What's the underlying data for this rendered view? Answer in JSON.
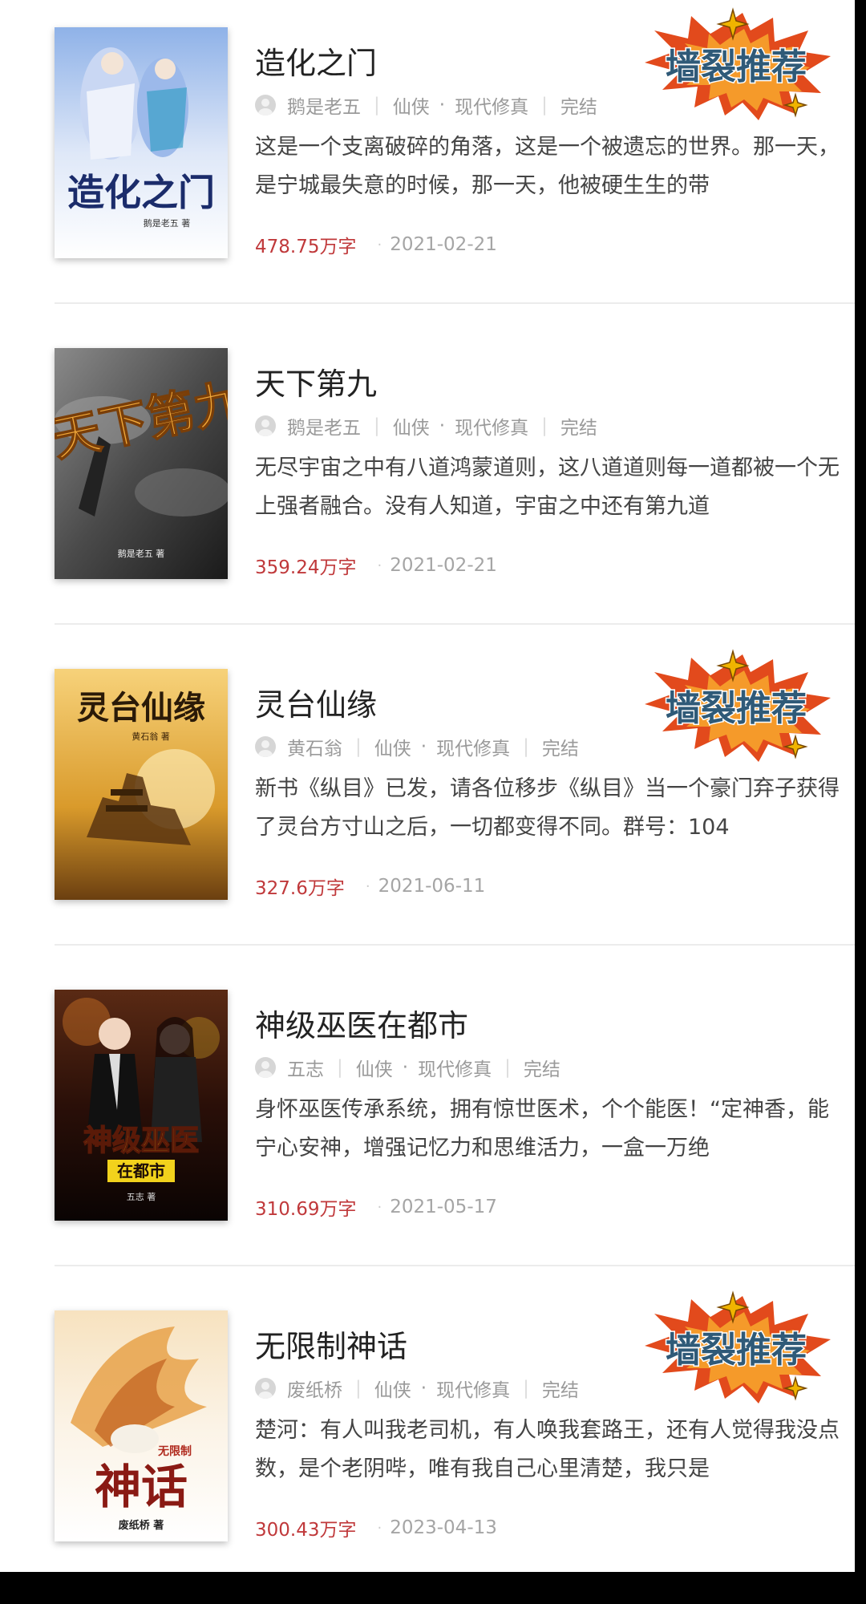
{
  "badge": {
    "text": "墙裂推荐",
    "colors": {
      "starburst_outer": "#e24a1c",
      "starburst_inner": "#f59a2a",
      "text": "#2f5a78",
      "sparkle": "#f0b400"
    }
  },
  "meta_labels": {
    "separator": "|",
    "dot": "·"
  },
  "colors": {
    "words": "#c0393b",
    "meta": "#9a9a9a",
    "title": "#222222",
    "desc": "#444444"
  },
  "books": [
    {
      "title": "造化之门",
      "author": "鹅是老五",
      "category": "仙侠",
      "subcategory": "现代修真",
      "status": "完结",
      "description": "这是一个支离破碎的角落，这是一个被遗忘的世界。那一天，是宁城最失意的时候，那一天，他被硬生生的带",
      "words": "478.75万字",
      "date": "2021-02-21",
      "recommended": true,
      "cover": {
        "title_text": "造化之门",
        "author_text": "鹅是老五 著",
        "palette": [
          "#dfe8f8",
          "#8fb2e8",
          "#1b2c6b"
        ]
      }
    },
    {
      "title": "天下第九",
      "author": "鹅是老五",
      "category": "仙侠",
      "subcategory": "现代修真",
      "status": "完结",
      "description": "无尽宇宙之中有八道鸿蒙道则，这八道道则每一道都被一个无上强者融合。没有人知道，宇宙之中还有第九道",
      "words": "359.24万字",
      "date": "2021-02-21",
      "recommended": false,
      "cover": {
        "title_text": "天下第九",
        "author_text": "鹅是老五 著",
        "palette": [
          "#6a6a6a",
          "#2a2a2a",
          "#f0a83a"
        ]
      }
    },
    {
      "title": "灵台仙缘",
      "author": "黄石翁",
      "category": "仙侠",
      "subcategory": "现代修真",
      "status": "完结",
      "description": "新书《纵目》已发，请各位移步《纵目》当一个豪门弃子获得了灵台方寸山之后，一切都变得不同。群号：104",
      "words": "327.6万字",
      "date": "2021-06-11",
      "recommended": true,
      "cover": {
        "title_text": "灵台仙缘",
        "author_text": "黄石翁 著",
        "palette": [
          "#f7d27a",
          "#d99a2b",
          "#6b3f10"
        ]
      }
    },
    {
      "title": "神级巫医在都市",
      "author": "五志",
      "category": "仙侠",
      "subcategory": "现代修真",
      "status": "完结",
      "description": "身怀巫医传承系统，拥有惊世医术，个个能医！“定神香，能宁心安神，增强记忆力和思维活力，一盒一万绝",
      "words": "310.69万字",
      "date": "2021-05-17",
      "recommended": false,
      "cover": {
        "title_text": "神级巫医",
        "subtitle_text": "在都市",
        "author_text": "五志 著",
        "palette": [
          "#3a1a10",
          "#140806",
          "#f2d21c"
        ]
      }
    },
    {
      "title": "无限制神话",
      "author": "废纸桥",
      "category": "仙侠",
      "subcategory": "现代修真",
      "status": "完结",
      "description": "楚河：有人叫我老司机，有人唤我套路王，还有人觉得我没点数，是个老阴哔，唯有我自己心里清楚，我只是",
      "words": "300.43万字",
      "date": "2023-04-13",
      "recommended": true,
      "cover": {
        "title_text": "神话",
        "subtitle_text": "无限制",
        "author_text": "废纸桥 著",
        "palette": [
          "#fbf3e6",
          "#e8a24a",
          "#8a1a14"
        ]
      }
    }
  ]
}
